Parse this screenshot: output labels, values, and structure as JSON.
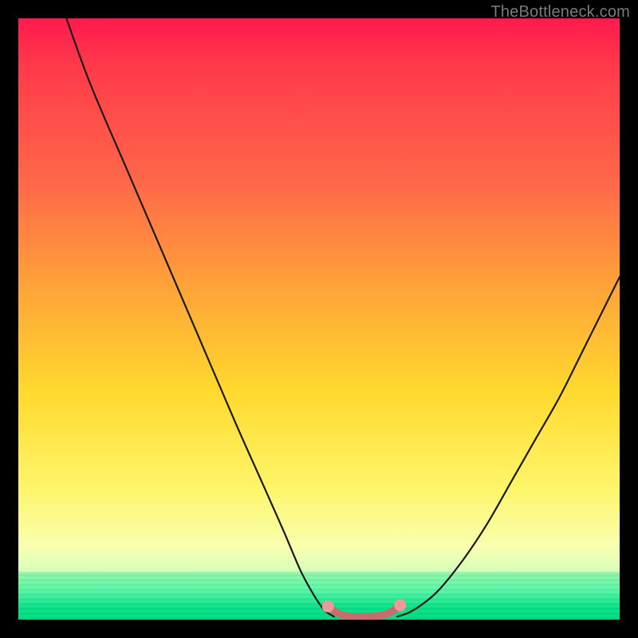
{
  "watermark": {
    "text": "TheBottleneck.com"
  },
  "palette": {
    "curve_stroke": "#1a1a1a",
    "marker_stroke": "#cc6b6b",
    "marker_fill": "#ef9a9a"
  },
  "chart_data": {
    "type": "line",
    "title": "",
    "xlabel": "",
    "ylabel": "",
    "xlim": [
      0,
      100
    ],
    "ylim": [
      0,
      100
    ],
    "series": [
      {
        "name": "left-curve",
        "x": [
          8,
          12,
          18,
          24,
          30,
          36,
          40,
          44,
          47,
          49.5,
          51,
          52.5
        ],
        "values": [
          100,
          89,
          75,
          61,
          47,
          33,
          24,
          15,
          8,
          3.5,
          1.5,
          0.5
        ]
      },
      {
        "name": "right-curve",
        "x": [
          63,
          65,
          67.5,
          70,
          74,
          78,
          82,
          86,
          90,
          94,
          98,
          100
        ],
        "values": [
          0.5,
          1.2,
          2.8,
          5,
          10,
          16,
          23,
          30,
          37,
          45,
          53,
          57
        ]
      },
      {
        "name": "valley-marker",
        "x": [
          51.5,
          53.5,
          55.5,
          57.5,
          59.5,
          61.5,
          63.5
        ],
        "values": [
          2.2,
          0.9,
          0.5,
          0.5,
          0.6,
          1.0,
          2.4
        ]
      }
    ]
  }
}
